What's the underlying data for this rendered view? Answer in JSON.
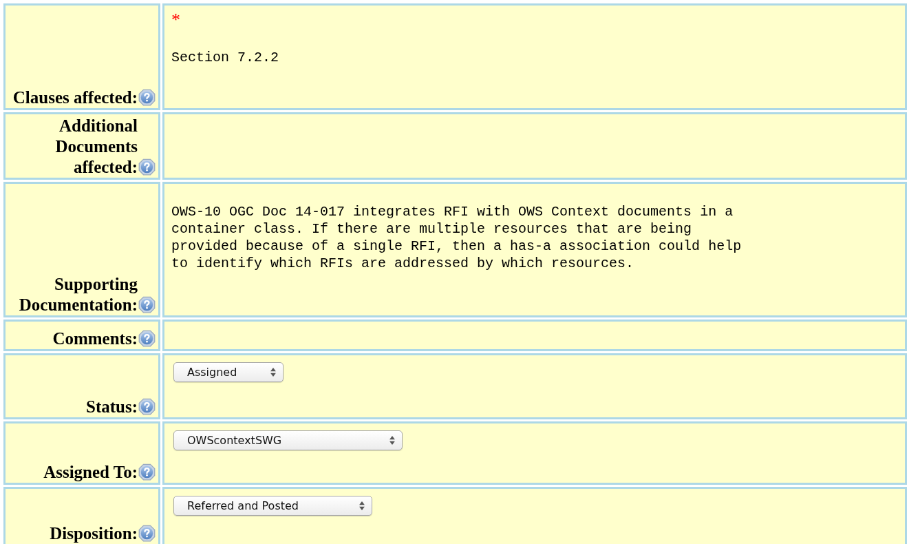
{
  "rows": [
    {
      "kind": "text",
      "label": "Clauses affected:",
      "required_mark": "*",
      "value": "Section 7.2.2"
    },
    {
      "kind": "text",
      "label": "Additional Documents affected:"
    },
    {
      "kind": "text",
      "label": "Supporting Documentation:",
      "value": "OWS-10 OGC Doc 14-017 integrates RFI with OWS Context documents in a\ncontainer class. If there are multiple resources that are being\nprovided because of a single RFI, then a has-a association could help\nto identify which RFIs are addressed by which resources."
    },
    {
      "kind": "text",
      "label": "Comments:"
    },
    {
      "kind": "select",
      "label": "Status:",
      "value": "Assigned"
    },
    {
      "kind": "select",
      "label": "Assigned To:",
      "value": "OWScontextSWG"
    },
    {
      "kind": "select",
      "label": "Disposition:",
      "value": "Referred and Posted"
    }
  ]
}
